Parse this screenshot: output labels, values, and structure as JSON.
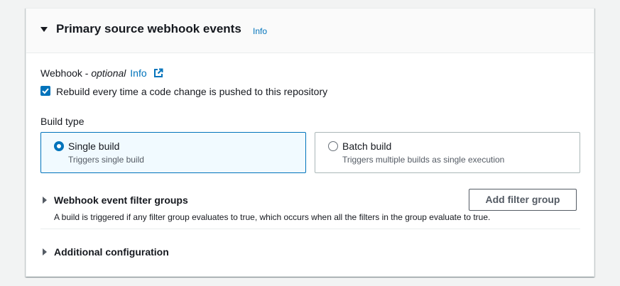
{
  "panel": {
    "title": "Primary source webhook events",
    "info_label": "Info"
  },
  "webhook": {
    "label": "Webhook - ",
    "optional_label": "optional",
    "info_label": "Info",
    "checkbox_label": "Rebuild every time a code change is pushed to this repository",
    "checkbox_checked": true
  },
  "build_type": {
    "label": "Build type",
    "options": [
      {
        "title": "Single build",
        "description": "Triggers single build",
        "selected": true
      },
      {
        "title": "Batch build",
        "description": "Triggers multiple builds as single execution",
        "selected": false
      }
    ]
  },
  "filter_groups": {
    "title": "Webhook event filter groups",
    "description": "A build is triggered if any filter group evaluates to true, which occurs when all the filters in the group evaluate to true.",
    "add_button_label": "Add filter group"
  },
  "additional": {
    "title": "Additional configuration"
  },
  "colors": {
    "accent": "#0073bb",
    "selected_tile_bg": "#f1faff",
    "header_bg": "#fafafa"
  }
}
